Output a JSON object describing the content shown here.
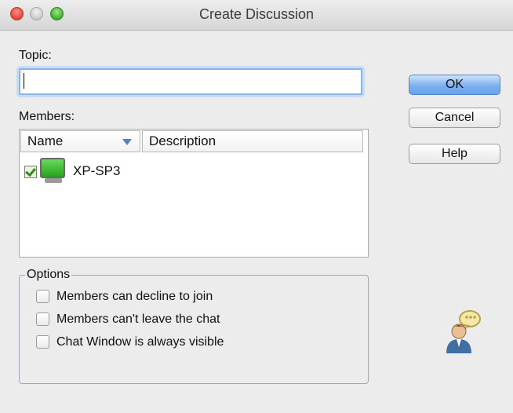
{
  "window": {
    "title": "Create Discussion"
  },
  "topic": {
    "label": "Topic:",
    "value": ""
  },
  "members": {
    "label": "Members:",
    "columns": [
      "Name",
      "Description"
    ],
    "rows": [
      {
        "name": "XP-SP3",
        "checked": true
      }
    ]
  },
  "buttons": {
    "ok": "OK",
    "cancel": "Cancel",
    "help": "Help"
  },
  "options": {
    "legend": "Options",
    "items": [
      {
        "label": "Members can decline to join",
        "checked": false
      },
      {
        "label": "Members can't leave the chat",
        "checked": false
      },
      {
        "label": "Chat Window is always visible",
        "checked": false
      }
    ]
  },
  "icons": {
    "chat": "chat-user-icon",
    "computer": "computer-icon"
  }
}
